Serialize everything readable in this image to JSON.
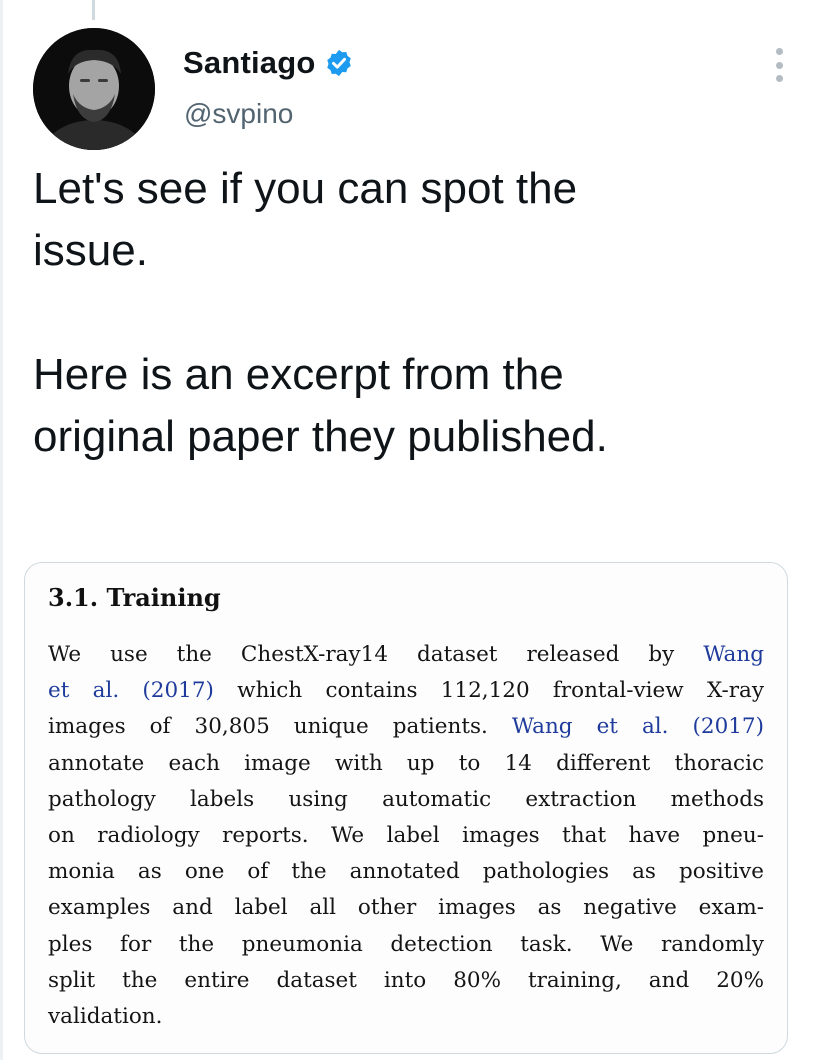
{
  "tweet": {
    "author_name": "Santiago",
    "author_handle": "@svpino",
    "paragraphs": [
      "Let's see if you can spot the\nissue.",
      "Here is an excerpt from the\noriginal paper they published."
    ]
  },
  "paper_excerpt": {
    "heading": "3.1. Training",
    "lines": [
      "We use the ChestX-ray14 dataset released by",
      "Wang",
      "et al. (2017)",
      "which contains 112,120 frontal-view X-ray",
      "images of 30,805 unique patients.",
      "Wang et al. (2017)",
      "annotate each image with up to 14 different thoracic",
      "pathology labels using automatic extraction methods",
      "on radiology reports. We label images that have pneu-",
      "monia as one of the annotated pathologies as positive",
      "examples and label all other images as negative exam-",
      "ples for the pneumonia detection task. We randomly",
      "split the entire dataset into 80% training, and 20%",
      "validation."
    ]
  },
  "icons": {
    "verified": "verified-badge-icon",
    "more": "more-options-icon"
  },
  "colors": {
    "verified_blue": "#1d9bf0",
    "citation_blue": "#1f3c9c",
    "handle_gray": "#536471"
  }
}
